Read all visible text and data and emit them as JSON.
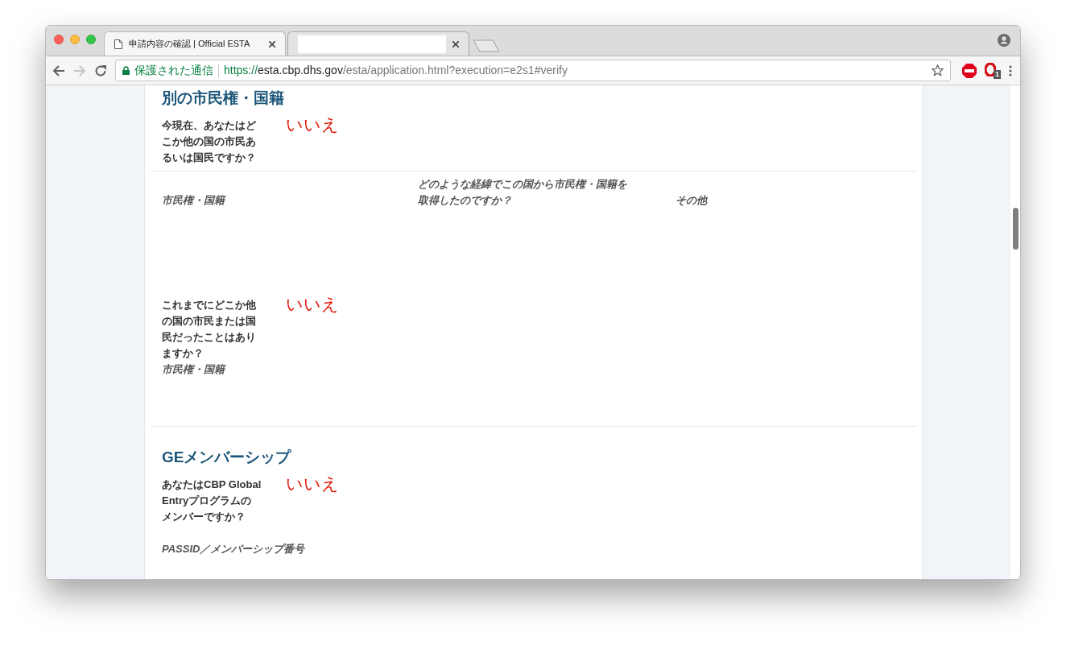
{
  "browser": {
    "tabs": [
      {
        "title": "申請内容の確認 | Official ESTA",
        "selected": true
      },
      {
        "selected": false
      }
    ],
    "address": {
      "security_label": "保護された通信",
      "scheme": "https://",
      "host": "esta.cbp.dhs.gov",
      "path": "/esta/application.html?execution=e2s1#verify"
    },
    "extension_badge": "1"
  },
  "sections": [
    {
      "title": "別の市民権・国籍",
      "items": [
        {
          "kind": "question",
          "label": "今現在、あなたはどこか他の国の市民あるいは国民ですか？",
          "answer": "いいえ"
        },
        {
          "kind": "columns",
          "columns": [
            "市民権・国籍",
            "どのような経緯でこの国から市民権・国籍を取得したのですか？",
            "その他"
          ]
        },
        {
          "kind": "question",
          "label": "これまでにどこか他の国の市民または国民だったことはありますか？",
          "answer": "いいえ",
          "sublabel": "市民権・国籍"
        }
      ]
    },
    {
      "title": "GEメンバーシップ",
      "items": [
        {
          "kind": "question",
          "label": "あなたはCBP Global Entryプログラムのメンバーですか？",
          "answer": "いいえ"
        },
        {
          "kind": "field_label",
          "label": "PASSID／メンバーシップ番号"
        }
      ]
    }
  ]
}
